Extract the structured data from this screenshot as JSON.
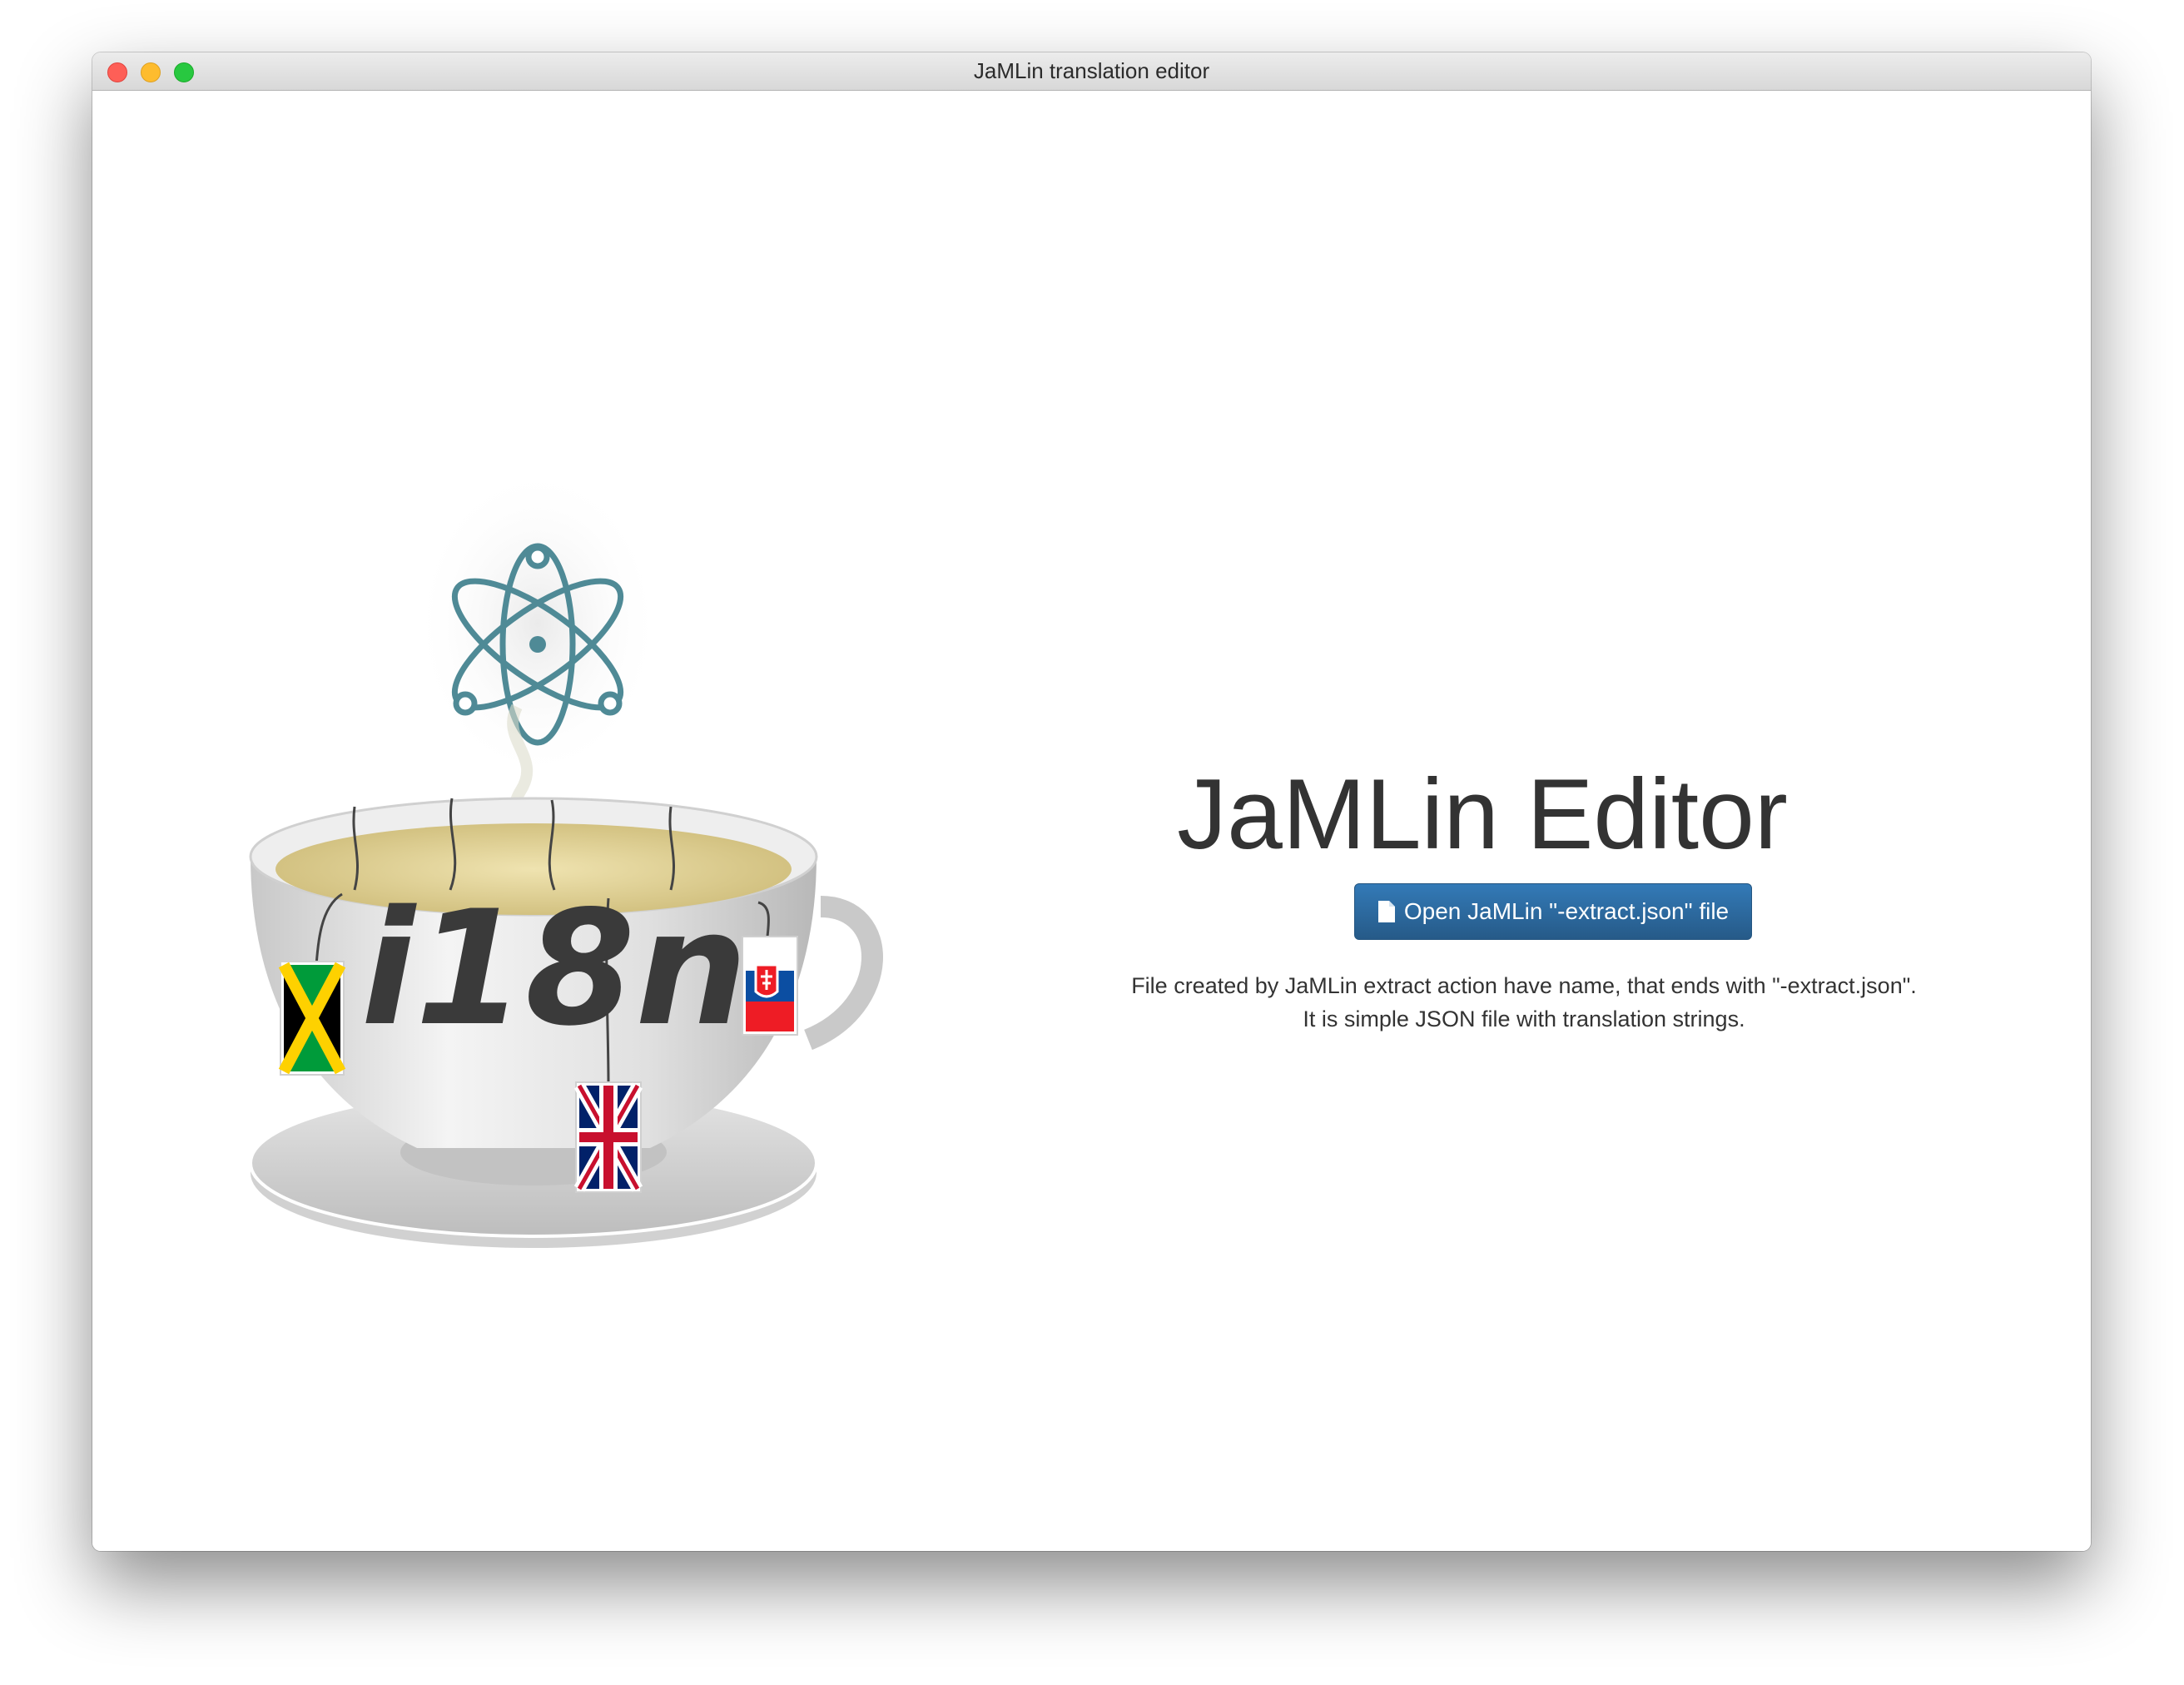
{
  "window": {
    "title": "JaMLin translation editor"
  },
  "logo": {
    "text": "i18n"
  },
  "main": {
    "heading": "JaMLin Editor",
    "open_button_label": "Open JaMLin \"-extract.json\" file",
    "description_line1": "File created by JaMLin extract action have name, that ends with \"-extract.json\".",
    "description_line2": "It is simple JSON file with translation strings."
  },
  "colors": {
    "button": "#337ab7",
    "heading": "#333333",
    "logo_accent": "#4f8a96"
  },
  "icons": [
    "close-button",
    "minimize-button",
    "zoom-button",
    "file-icon",
    "electron-atom-icon",
    "jamaica-flag",
    "uk-flag",
    "slovakia-flag"
  ]
}
